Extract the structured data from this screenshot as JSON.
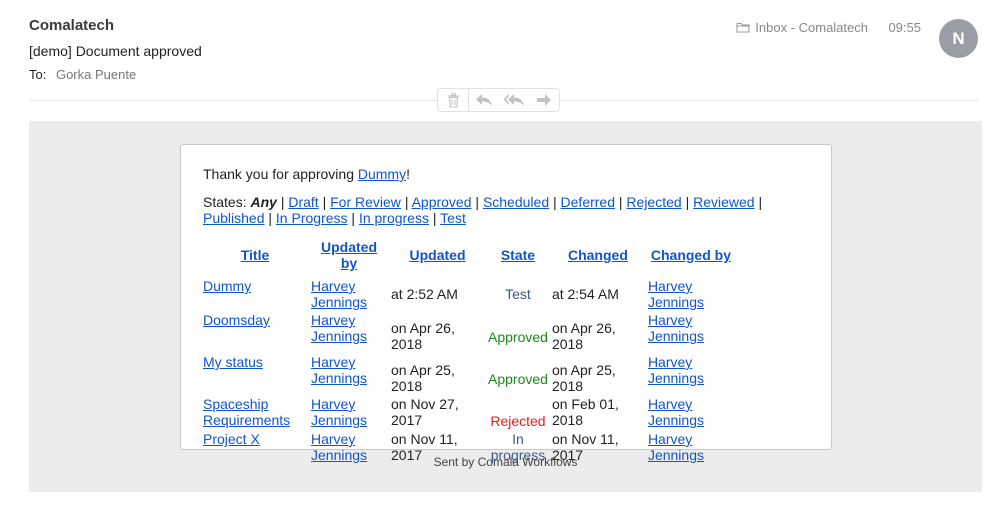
{
  "header": {
    "sender": "Comalatech",
    "subject": "[demo] Document approved",
    "to_label": "To:",
    "to_value": "Gorka Puente",
    "mailbox": "Inbox - Comalatech",
    "time": "09:55",
    "avatar_initial": "N"
  },
  "toolbar": {
    "icons": [
      "trash-icon",
      "reply-icon",
      "reply-all-icon",
      "forward-icon"
    ]
  },
  "email": {
    "thanks_prefix": "Thank you for approving ",
    "thanks_link": "Dummy",
    "thanks_suffix": "!",
    "states_label": "States:",
    "states_any": "Any",
    "states": [
      "Draft",
      "For Review",
      "Approved",
      "Scheduled",
      "Deferred",
      "Rejected",
      "Reviewed",
      "Published",
      "In Progress",
      "In progress",
      "Test"
    ],
    "separator": "|",
    "columns": [
      "Title",
      "Updated by",
      "Updated",
      "State",
      "Changed",
      "Changed by"
    ],
    "rows": [
      {
        "title": "Dummy",
        "updated_by": "Harvey Jennings",
        "updated": "at 2:52 AM",
        "state": "Test",
        "changed": "at 2:54 AM",
        "changed_by": "Harvey Jennings"
      },
      {
        "title": "Doomsday",
        "updated_by": "Harvey Jennings",
        "updated": "on Apr 26, 2018",
        "state": "Approved",
        "changed": "on Apr 26, 2018",
        "changed_by": "Harvey Jennings"
      },
      {
        "title": "My status",
        "updated_by": "Harvey Jennings",
        "updated": "on Apr 25, 2018",
        "state": "Approved",
        "changed": "on Apr 25, 2018",
        "changed_by": "Harvey Jennings"
      },
      {
        "title": "Spaceship Requirements",
        "updated_by": "Harvey Jennings",
        "updated": "on Nov 27, 2017",
        "state": "Rejected",
        "changed": "on Feb 01, 2018",
        "changed_by": "Harvey Jennings"
      },
      {
        "title": "Project X",
        "updated_by": "Harvey Jennings",
        "updated": "on Nov 11, 2017",
        "state": "In progress",
        "changed": "on Nov 11, 2017",
        "changed_by": "Harvey Jennings"
      }
    ],
    "footer": "Sent by Comala Workflows"
  },
  "colors": {
    "link": "#1155cc",
    "approved": "#1a8a1a",
    "rejected": "#e02020",
    "neutral_state": "#3b5a8c",
    "canvas_bg": "#ececec",
    "avatar_bg": "#9a9ea4"
  }
}
